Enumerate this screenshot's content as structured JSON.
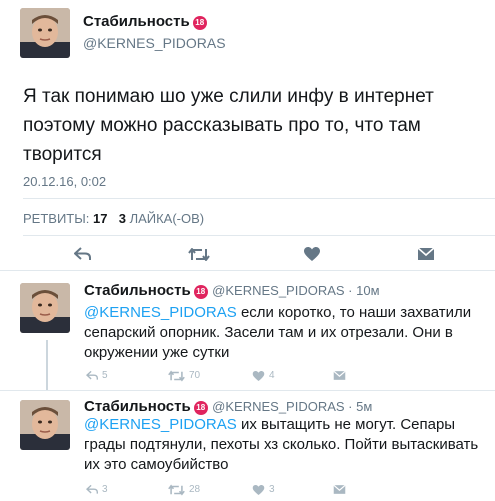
{
  "main_tweet": {
    "author_name": "Стабильность",
    "badge": "18",
    "handle": "@KERNES_PIDORAS",
    "text": "Я так понимаю шо уже слили инфу в интернет поэтому можно рассказывать про то, что там творится",
    "timestamp": "20.12.16, 0:02",
    "retweets_label": "РЕТВИТЫ:",
    "retweets_count": "17",
    "likes_count": "3",
    "likes_label": "ЛАЙКА(-ОВ)"
  },
  "replies": [
    {
      "author_name": "Стабильность",
      "badge": "18",
      "handle": "@KERNES_PIDORAS",
      "time": "10м",
      "mention": "@KERNES_PIDORAS",
      "text": " если коротко, то наши захватили сепарский опорник. Засели там и их отрезали. Они в окружении уже сутки",
      "reply_count": "5",
      "retweet_count": "70",
      "like_count": "4"
    },
    {
      "author_name": "Стабильность",
      "badge": "18",
      "handle": "@KERNES_PIDORAS",
      "time": "5м",
      "mention": "@KERNES_PIDORAS",
      "text": " их вытащить не могут. Сепары грады подтянули, пехоты хз сколько. Пойти вытаскивать их это самоубийство",
      "reply_count": "3",
      "retweet_count": "28",
      "like_count": "3"
    }
  ],
  "colors": {
    "accent": "#1da1f2",
    "muted": "#657786",
    "badge": "#e0245e"
  }
}
